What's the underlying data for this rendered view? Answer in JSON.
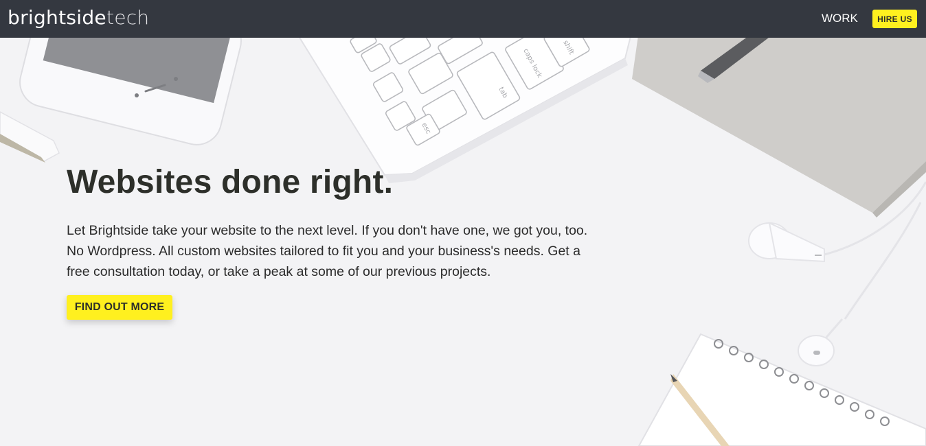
{
  "nav": {
    "logo_primary": "brightside",
    "logo_secondary": "tech",
    "work_label": "WORK",
    "hire_label": "HIRE US"
  },
  "hero": {
    "title": "Websites done right.",
    "body": "Let Brightside take your website to the next level. If you don't have one, we got you, too. No Wordpress. All custom websites tailored to fit you and your business's needs. Get a free consultation today, or take a peak at some of our previous projects.",
    "cta_label": "FIND OUT MORE"
  },
  "keyboard_keys": [
    "shift",
    "caps lock",
    "tab",
    "esc"
  ],
  "colors": {
    "nav_bg": "#343840",
    "accent": "#fff01f",
    "page_bg": "#f3f3f5",
    "heading": "#2d2f2a"
  }
}
